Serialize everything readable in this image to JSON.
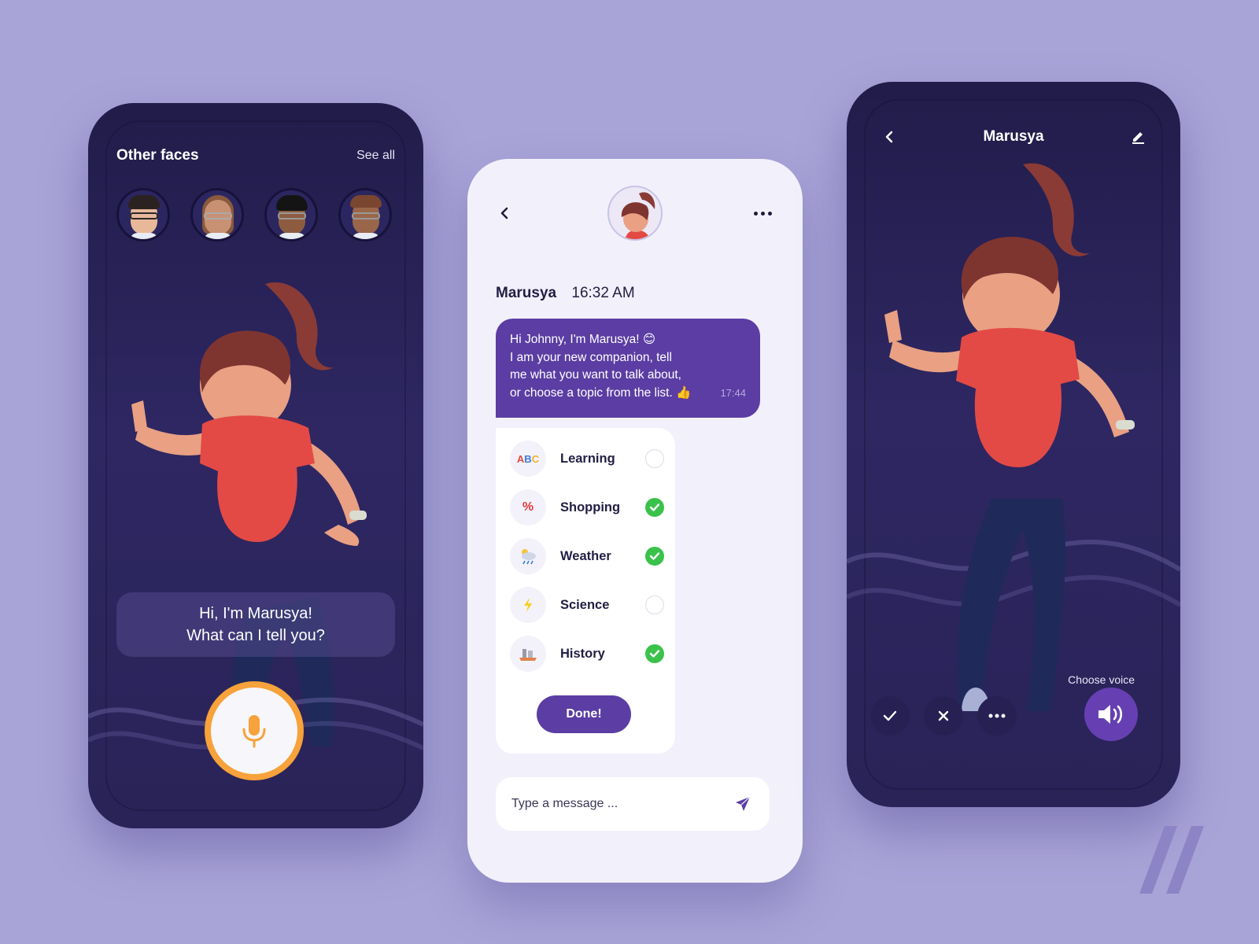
{
  "colors": {
    "background": "#a9a4d8",
    "dark_phone": "#2a2358",
    "accent_purple": "#5b3da3",
    "voice_button": "#6640b2",
    "mic_ring": "#f7a23a",
    "check_green": "#3ac24b",
    "light_phone": "#f2f0fb"
  },
  "left_screen": {
    "section_title": "Other faces",
    "see_all_label": "See all",
    "faces": [
      {
        "name": "face-avatar-1",
        "icon": "avatar-man-glasses"
      },
      {
        "name": "face-avatar-2",
        "icon": "avatar-woman-long-hair"
      },
      {
        "name": "face-avatar-3",
        "icon": "avatar-man-dark-hair"
      },
      {
        "name": "face-avatar-4",
        "icon": "avatar-man-beard"
      }
    ],
    "greeting_line1": "Hi, I'm Marusya!",
    "greeting_line2": "What can I tell you?",
    "mic_icon": "microphone-icon"
  },
  "chat_screen": {
    "back_icon": "chevron-left-icon",
    "more_icon": "more-horizontal-icon",
    "sender_name": "Marusya",
    "sender_time": "16:32 AM",
    "message": {
      "lines": [
        "Hi Johnny, I'm Marusya! 😊",
        "I am your new companion, tell",
        "me what you want to talk about,",
        "or choose a topic from the list. 👍"
      ],
      "time": "17:44"
    },
    "topics": [
      {
        "label": "Learning",
        "icon": "abc-book-icon",
        "glyph": "📖",
        "checked": false
      },
      {
        "label": "Shopping",
        "icon": "percent-icon",
        "glyph": "%",
        "checked": true
      },
      {
        "label": "Weather",
        "icon": "rain-cloud-icon",
        "glyph": "🌦",
        "checked": true
      },
      {
        "label": "Science",
        "icon": "lightning-icon",
        "glyph": "⚡",
        "checked": false
      },
      {
        "label": "History",
        "icon": "castle-ruins-icon",
        "glyph": "🏛",
        "checked": true
      }
    ],
    "done_label": "Done!",
    "input_placeholder": "Type a message ...",
    "send_icon": "send-icon"
  },
  "right_screen": {
    "title": "Marusya",
    "back_icon": "chevron-left-icon",
    "edit_icon": "pencil-icon",
    "choose_voice_label": "Choose voice",
    "controls": [
      {
        "name": "accept-button",
        "icon": "check-icon"
      },
      {
        "name": "reject-button",
        "icon": "close-icon"
      },
      {
        "name": "more-options-button",
        "icon": "more-horizontal-icon"
      }
    ],
    "voice_icon": "speaker-volume-icon"
  }
}
